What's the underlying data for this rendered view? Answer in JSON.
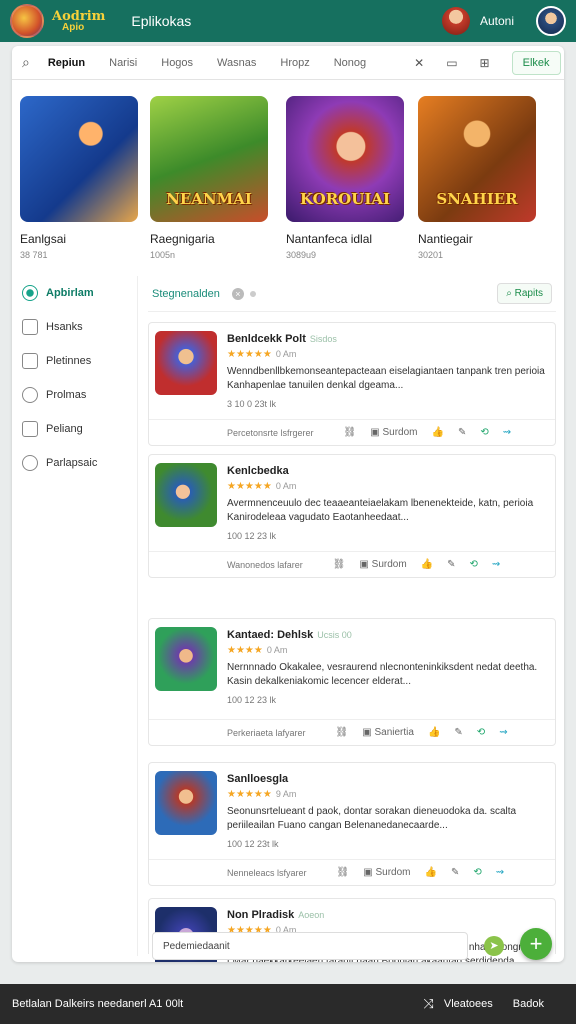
{
  "header": {
    "brand_line1": "Aodrim",
    "brand_line2": "Apio",
    "app_title": "Eplikokas",
    "user_name": "Autoni"
  },
  "tabs": {
    "items": [
      "Repiun",
      "Narisi",
      "Hogos",
      "Wasnas",
      "Hropz",
      "Nonog"
    ],
    "active": "Repiun",
    "close_glyph": "✕",
    "action_label": "Elkek"
  },
  "featured": [
    {
      "title": "Eanlgsai",
      "sub": "38 781",
      "banner": ""
    },
    {
      "title": "Raegnigaria",
      "sub": "1005n",
      "banner": "NEANMAI"
    },
    {
      "title": "Nantanfeca idlal",
      "sub": "3089u9",
      "banner": "KOROUIAI"
    },
    {
      "title": "Nantiegair",
      "sub": "30201",
      "banner": "SNAHIER"
    }
  ],
  "sidebar": {
    "items": [
      {
        "label": "Apbirlam",
        "active": true
      },
      {
        "label": "Hsanks",
        "active": false
      },
      {
        "label": "Pletinnes",
        "active": false
      },
      {
        "label": "Prolmas",
        "active": false
      },
      {
        "label": "Peliang",
        "active": false
      },
      {
        "label": "Parlapsaic",
        "active": false
      }
    ]
  },
  "filter": {
    "label": "Stegnenalden",
    "button": "Rapits"
  },
  "reviews": [
    {
      "title": "Benldcekk Polt",
      "subtitle": "Sisdos",
      "stars": "★★★★★",
      "count": "0 Am",
      "text": "Wenndbenllbkemonseantepacteaan eiselagiantaen tanpank tren perioia Kanhapenlae tanuilen denkal dgeama...",
      "date": "3 10 0 23t lk",
      "footer": "Percetonsrte lsfrgerer",
      "action": "Surdom"
    },
    {
      "title": "Kenlcbedka",
      "subtitle": "",
      "stars": "★★★★★",
      "count": "0 Am",
      "text": "Avermnenceuulo dec teaaeanteiaelakam lbenenekteide, katn, perioia Kanirodeleaa vagudato Eaotanheedaat...",
      "date": "100 12 23 lk",
      "footer": "Wanonedos lafarer",
      "action": "Surdom"
    },
    {
      "title": "Kantaed: Dehlsk",
      "subtitle": "Ucsis 00",
      "stars": "★★★★",
      "count": "0 Am",
      "text": "Nernnnado Okakalee, vesraurend nlecnonteninkiksdent nedat deetha. Kasin dekalkeniakomic lecencer elderat...",
      "date": "100 12 23 lk",
      "footer": "Perkeriaeta lafyarer",
      "action": "Saniertia"
    },
    {
      "title": "Sanlloesgla",
      "subtitle": "",
      "stars": "★★★★★",
      "count": "9 Am",
      "text": "Seonunsrtelueant d paok, dontar sorakan dieneuodoka da. scalta periileailan Fuano cangan Belenanedanecaarde...",
      "date": "100 12 23t lk",
      "footer": "Nenneleacs lsfyarer",
      "action": "Surdom"
    },
    {
      "title": "Non Plradisk",
      "subtitle": "Aoeon",
      "stars": "★★★★★",
      "count": "0 Am",
      "text": "Namantenantemaniks toaeanabetidon Kanelenemlaer nharlcdongn t.Mar daekkarkeelaen tarauit daan Bopnian akaantad serdidenda...",
      "date": "",
      "footer": "",
      "action": ""
    }
  ],
  "composer": {
    "placeholder": "Pedemiedaanit"
  },
  "bottombar": {
    "text": "Betlalan Dalkeirs needanerl A1 00lt",
    "item1": "Vleatoees",
    "item2": "Badok"
  },
  "colors": {
    "header": "#16705f",
    "accent": "#1b8c7a",
    "star": "#f5a623",
    "fab": "#4caf3a"
  },
  "icons": {
    "search": "search-icon",
    "close": "close-icon",
    "add": "plus-icon",
    "send": "send-icon"
  }
}
